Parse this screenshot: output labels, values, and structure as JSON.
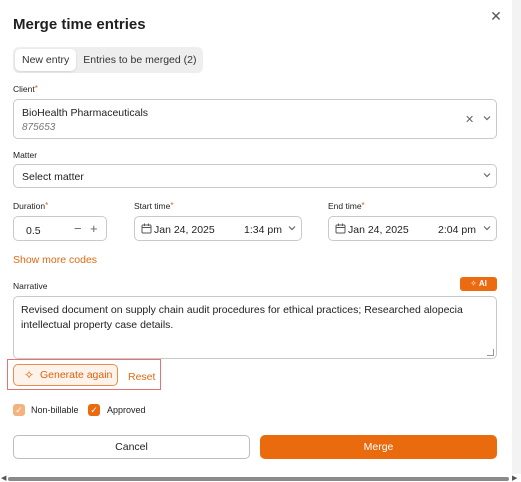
{
  "dialog": {
    "title": "Merge time entries",
    "close_icon": "close-icon"
  },
  "tabs": [
    {
      "label": "New entry",
      "active": true
    },
    {
      "label": "Entries to be merged (2)",
      "active": false
    }
  ],
  "client": {
    "label": "Client",
    "required_mark": "*",
    "name": "BioHealth Pharmaceuticals",
    "id": "875653"
  },
  "matter": {
    "label": "Matter",
    "placeholder": "Select matter"
  },
  "duration": {
    "label": "Duration",
    "required_mark": "*",
    "value": "0.5",
    "minus": "−",
    "plus": "+"
  },
  "start_time": {
    "label": "Start time",
    "required_mark": "*",
    "date": "Jan 24, 2025",
    "time": "1:34 pm"
  },
  "end_time": {
    "label": "End time",
    "required_mark": "*",
    "date": "Jan 24, 2025",
    "time": "2:04 pm"
  },
  "show_more_codes": "Show more codes",
  "narrative": {
    "label": "Narrative",
    "ai_label": "AI",
    "text": "Revised document on supply chain audit procedures for ethical practices; Researched alopecia intellectual property case details."
  },
  "generate_again": "Generate again",
  "reset": "Reset",
  "checkboxes": [
    {
      "label": "Non-billable",
      "checked": true
    },
    {
      "label": "Approved",
      "checked": true
    }
  ],
  "buttons": {
    "cancel": "Cancel",
    "merge": "Merge"
  },
  "colors": {
    "accent": "#ea6a0e",
    "accent_light": "#f4b27f",
    "highlight_border": "#e57373"
  }
}
